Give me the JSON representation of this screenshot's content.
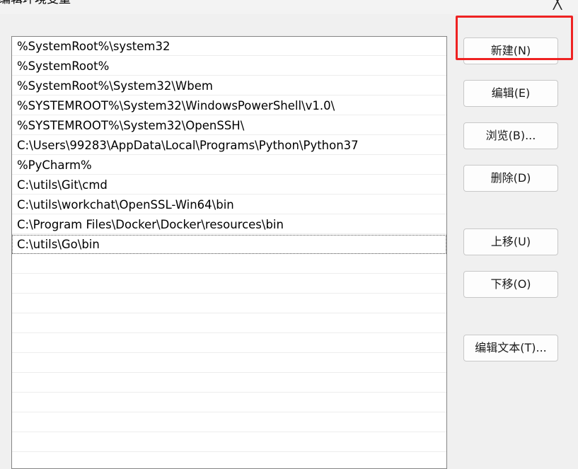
{
  "window": {
    "title": "编辑环境变量",
    "close_glyph": "╳"
  },
  "path_list": {
    "entries": [
      "%SystemRoot%\\system32",
      "%SystemRoot%",
      "%SystemRoot%\\System32\\Wbem",
      "%SYSTEMROOT%\\System32\\WindowsPowerShell\\v1.0\\",
      "%SYSTEMROOT%\\System32\\OpenSSH\\",
      "C:\\Users\\99283\\AppData\\Local\\Programs\\Python\\Python37",
      "%PyCharm%",
      "C:\\utils\\Git\\cmd",
      "C:\\utils\\workchat\\OpenSSL-Win64\\bin",
      "C:\\Program Files\\Docker\\Docker\\resources\\bin",
      "C:\\utils\\Go\\bin"
    ],
    "selected_index": 10
  },
  "buttons": {
    "new": "新建(N)",
    "edit": "编辑(E)",
    "browse": "浏览(B)...",
    "delete": "删除(D)",
    "move_up": "上移(U)",
    "move_down": "下移(O)",
    "edit_text": "编辑文本(T)..."
  },
  "annotation": {
    "highlight_color": "#ee2222"
  }
}
